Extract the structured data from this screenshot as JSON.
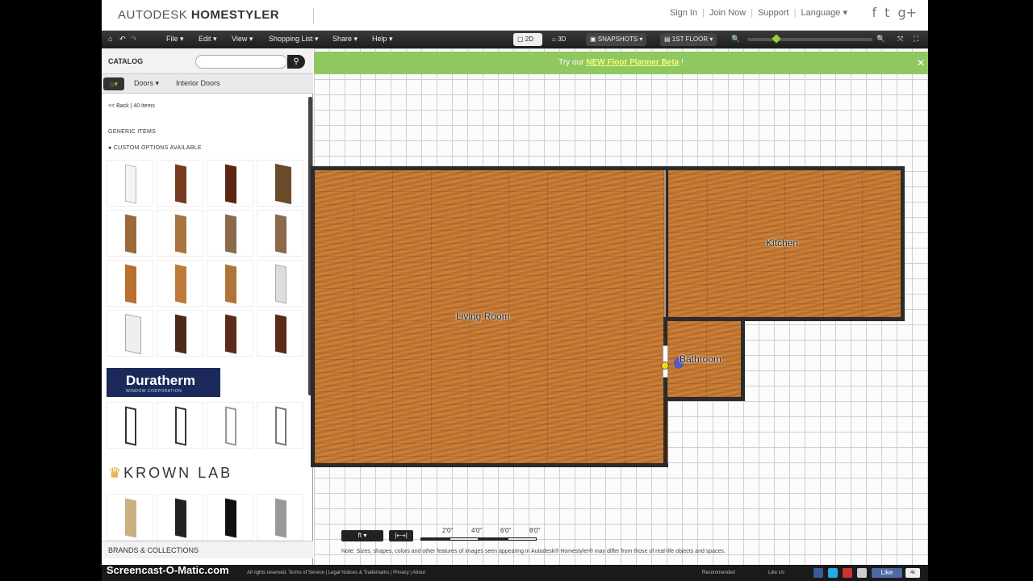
{
  "header": {
    "logo_light": "AUTODESK",
    "logo_bold": "HOMESTYLER",
    "links": [
      "Sign In",
      "Join Now",
      "Support",
      "Language ▾"
    ],
    "social": [
      "f",
      "t",
      "g+"
    ]
  },
  "menubar": {
    "items": [
      "File ▾",
      "Edit ▾",
      "View ▾",
      "Shopping List ▾",
      "Share ▾",
      "Help ▾"
    ],
    "view_2d": "2D",
    "view_3d": "3D",
    "snapshots": "SNAPSHOTS ▾",
    "floor": "1ST FLOOR ▾"
  },
  "catalog": {
    "title": "CATALOG",
    "search_placeholder": "",
    "breadcrumb": [
      "Doors ▾",
      "Interior Doors"
    ],
    "back_text": "<< Back | 40 items",
    "generic_items": "GENERIC ITEMS",
    "custom_options": "CUSTOM OPTIONS AVAILABLE",
    "duratherm": "Duratherm",
    "duratherm_sub": "WINDOW CORPORATION",
    "krown": "KROWN LAB",
    "brands_collections": "BRANDS & COLLECTIONS"
  },
  "banner": {
    "prefix": "Try our",
    "link": "NEW Floor Planner Beta",
    "suffix": "!"
  },
  "rooms": {
    "living": "Living Room",
    "kitchen": "Kitchen",
    "bathroom": "Bathroom"
  },
  "scale": {
    "labels": [
      "2'0\"",
      "4'0\"",
      "6'0\"",
      "8'0\""
    ]
  },
  "note": "Note: Sizes, shapes, colors and other features of images seen appearing in Autodesk® Homestyler® may differ from those of real-life objects and spaces.",
  "footer": {
    "copyright": "All rights reserved. Terms of Service | Legal Notices & Trademarks | Privacy | About",
    "recommended": "Recommended",
    "like_us": "Like Us",
    "fb_like": "Like"
  },
  "watermark": "Screencast-O-Matic.com",
  "colors": {
    "wood": "#c7772f",
    "banner": "#8fc761",
    "wall": "#2b2b2b"
  }
}
